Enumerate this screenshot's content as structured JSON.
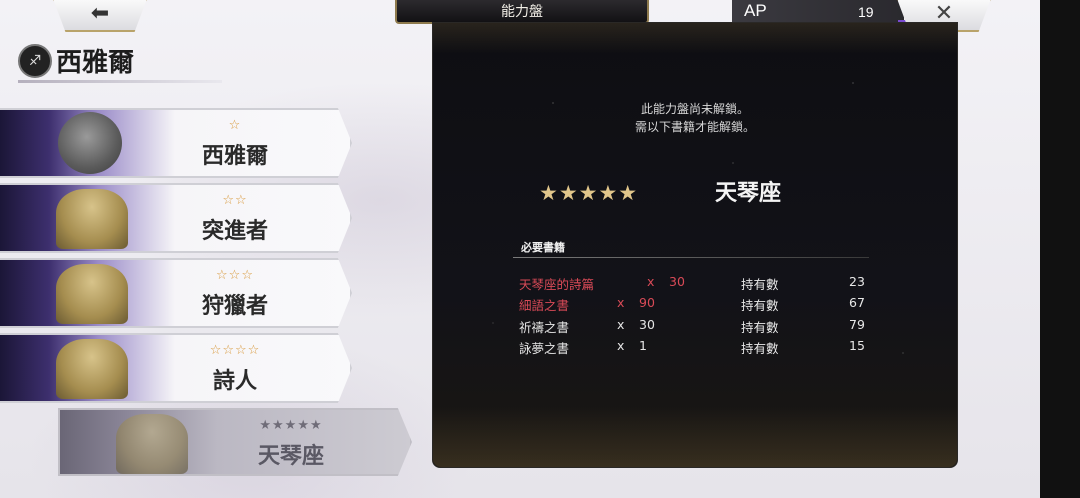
{
  "topbar": {
    "back_glyph": "⬅",
    "close_glyph": "✕",
    "title": "能力盤",
    "ap_label": "AP",
    "ap_value": "19"
  },
  "character": {
    "emblem_glyph": "♐",
    "name": "西雅爾"
  },
  "tiers": [
    {
      "stars": "☆",
      "name": "西雅爾",
      "state": "unlocked"
    },
    {
      "stars": "☆☆",
      "name": "突進者",
      "state": "unlocked"
    },
    {
      "stars": "☆☆☆",
      "name": "狩獵者",
      "state": "unlocked"
    },
    {
      "stars": "☆☆☆☆",
      "name": "詩人",
      "state": "unlocked"
    },
    {
      "stars": "★★★★★",
      "name": "天琴座",
      "state": "locked-selected"
    }
  ],
  "panel": {
    "lock_message_line1": "此能力盤尚未解鎖。",
    "lock_message_line2": "需以下書籍才能解鎖。",
    "board_stars": "★★★★★",
    "board_name": "天琴座",
    "requirements_header": "必要書籍",
    "requirements": [
      {
        "name": "天琴座的詩篇",
        "x": "x",
        "need": "30",
        "have_label": "持有數",
        "have": "23",
        "status": "short"
      },
      {
        "name": "細語之書",
        "x": "x",
        "need": "90",
        "have_label": "持有數",
        "have": "67",
        "status": "short"
      },
      {
        "name": "祈禱之書",
        "x": "x",
        "need": "30",
        "have_label": "持有數",
        "have": "79",
        "status": "ok"
      },
      {
        "name": "詠夢之書",
        "x": "x",
        "need": "1",
        "have_label": "持有數",
        "have": "15",
        "status": "ok"
      }
    ]
  },
  "colors": {
    "shortage_red": "#d94a57",
    "star_gold": "#e1c68b",
    "tier_star_orange": "#d99a3e"
  }
}
